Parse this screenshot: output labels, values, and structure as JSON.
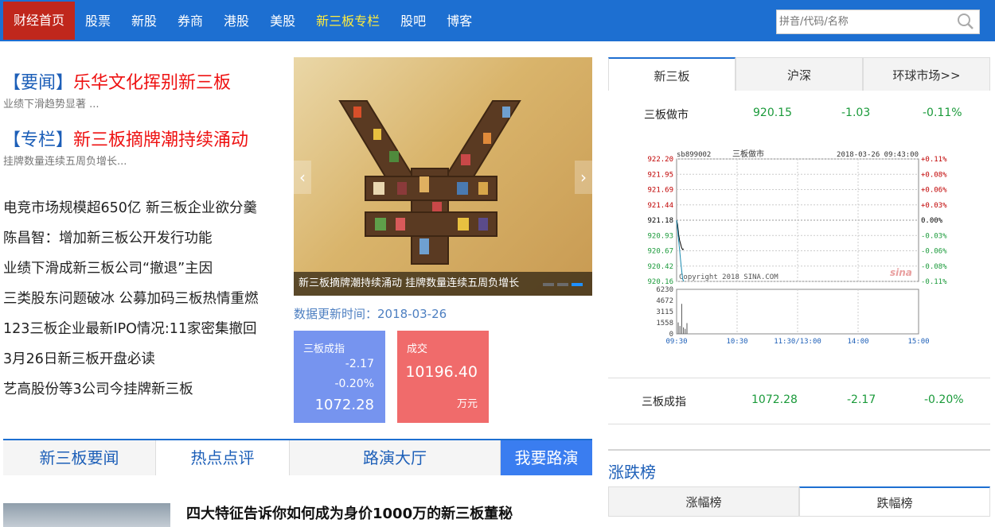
{
  "nav": {
    "home": "财经首页",
    "items": [
      "股票",
      "新股",
      "券商",
      "港股",
      "美股",
      "新三板专栏",
      "股吧",
      "博客"
    ],
    "highlight_index": 5,
    "search_placeholder": "拼音/代码/名称"
  },
  "headlines": [
    {
      "tag": "【要闻】",
      "title": "乐华文化挥别新三板",
      "sub": "业绩下滑趋势显著 ..."
    },
    {
      "tag": "【专栏】",
      "title": "新三板摘牌潮持续涌动",
      "sub": "挂牌数量连续五周负增长..."
    }
  ],
  "news": [
    "电竞市场规模超650亿 新三板企业欲分羹",
    "陈昌智：增加新三板公开发行功能",
    "业绩下滑成新三板公司“撤退”主因",
    "三类股东问题破冰 公募加码三板热情重燃",
    "123三板企业最新IPO情况:11家密集撤回",
    "3月26日新三板开盘必读",
    "艺高股份等3公司今挂牌新三板"
  ],
  "banner": {
    "caption": "新三板摘牌潮持续涌动 挂牌数量连续五周负增长",
    "prev": "‹",
    "next": "›",
    "slide_count": 3,
    "active_slide": 3
  },
  "update_time": "数据更新时间：2018-03-26",
  "cards": {
    "index": {
      "title": "三板成指",
      "change": "-2.17",
      "pct": "-0.20%",
      "value": "1072.28"
    },
    "volume": {
      "title": "成交",
      "value": "10196.40",
      "unit": "万元"
    }
  },
  "tabs": [
    "新三板要闻",
    "热点点评",
    "路演大厅",
    "我要路演"
  ],
  "active_tab": 1,
  "article": {
    "title": "四大特征告诉你如何成为身价1000万的新三板董秘"
  },
  "market": {
    "tabs": [
      "新三板",
      "沪深",
      "环球市场>>"
    ],
    "row1": {
      "name": "三板做市",
      "price": "920.15",
      "change": "-1.03",
      "pct": "-0.11%"
    },
    "row2": {
      "name": "三板成指",
      "price": "1072.28",
      "change": "-2.17",
      "pct": "-0.20%"
    }
  },
  "rank": {
    "title": "涨跌榜",
    "tabs": [
      "涨幅榜",
      "跌幅榜"
    ]
  },
  "colors": {
    "nav_bg": "#1d6fd1",
    "home_bg": "#c0271c",
    "up": "#c00000",
    "down": "#1a9a3a",
    "link": "#1d5fb8"
  },
  "chart_data": {
    "type": "line",
    "code": "sb899002",
    "name": "三板做市",
    "datetime": "2018-03-26  09:43:00",
    "copyright": "Copyright 2018 SINA.COM",
    "watermark": "sina",
    "price_ticks": [
      "922.20",
      "921.95",
      "921.69",
      "921.44",
      "921.18",
      "920.93",
      "920.67",
      "920.42",
      "920.16"
    ],
    "pct_ticks": [
      "+0.11%",
      "+0.08%",
      "+0.06%",
      "+0.03%",
      "0.00%",
      "-0.03%",
      "-0.06%",
      "-0.08%",
      "-0.11%"
    ],
    "volume_ticks": [
      "6230",
      "4672",
      "3115",
      "1558",
      "0"
    ],
    "time_ticks": [
      "09:30",
      "10:30",
      "11:30/13:00",
      "14:00",
      "15:00"
    ],
    "prev_close": 921.18,
    "ylim": [
      920.16,
      922.2
    ],
    "series": [
      {
        "values": [
          921.18,
          921.1,
          920.95,
          920.84,
          920.78,
          920.72,
          920.69,
          920.7
        ]
      },
      {
        "values": [
          921.18,
          921.02,
          920.85,
          920.68,
          920.5,
          920.35,
          920.2,
          920.16
        ]
      }
    ],
    "volume": [
      1600,
      1100,
      4200,
      900,
      700,
      1500
    ]
  }
}
